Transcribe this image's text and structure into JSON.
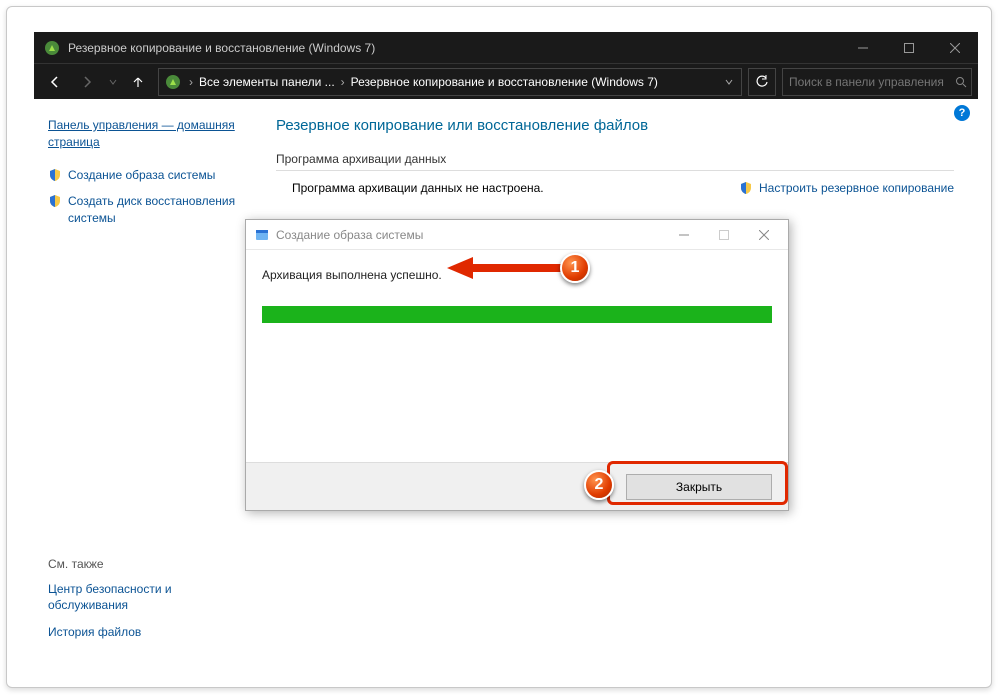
{
  "window": {
    "title": "Резервное копирование и восстановление (Windows 7)"
  },
  "nav": {
    "breadcrumb": {
      "seg1": "Все элементы панели ...",
      "seg2": "Резервное копирование и восстановление (Windows 7)"
    },
    "search_placeholder": "Поиск в панели управления"
  },
  "sidebar": {
    "home": "Панель управления — домашняя страница",
    "link1": "Создание образа системы",
    "link2": "Создать диск восстановления системы",
    "see_also_heading": "См. также",
    "see_also_1": "Центр безопасности и обслуживания",
    "see_also_2": "История файлов"
  },
  "main": {
    "heading": "Резервное копирование или восстановление файлов",
    "section": "Программа архивации данных",
    "status": "Программа архивации данных не настроена.",
    "configure_link": "Настроить резервное копирование"
  },
  "dialog": {
    "title": "Создание образа системы",
    "message": "Архивация выполнена успешно.",
    "close_btn": "Закрыть"
  },
  "annotations": {
    "badge1": "1",
    "badge2": "2"
  },
  "help_icon": "?"
}
